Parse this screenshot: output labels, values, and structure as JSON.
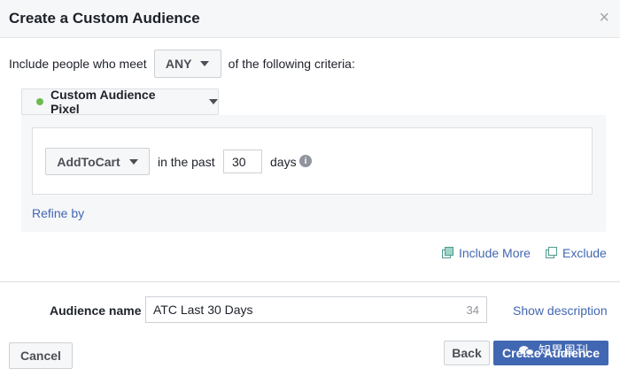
{
  "dialog": {
    "title": "Create a Custom Audience",
    "close_icon": "×"
  },
  "criteria": {
    "prefix": "Include people who meet",
    "match_value": "ANY",
    "suffix": "of the following criteria:"
  },
  "source": {
    "label": "Custom Audience Pixel",
    "status_color": "#6bbb4f"
  },
  "rule": {
    "event": "AddToCart",
    "in_the_past_label": "in the past",
    "days_value": "30",
    "days_label": "days",
    "info_icon": "i"
  },
  "refine_label": "Refine by",
  "include_more_label": "Include More",
  "exclude_label": "Exclude",
  "audience": {
    "name_label": "Audience name",
    "name_value": "ATC Last 30 Days",
    "chars_remaining": "34",
    "show_description_label": "Show description"
  },
  "footer": {
    "cancel_label": "Cancel",
    "back_label": "Back",
    "create_label": "Create Audience"
  },
  "watermark": {
    "text": "知界周刊"
  },
  "colors": {
    "link": "#4267b2",
    "primary_button": "#4267b2",
    "panel_bg": "#f6f7f9"
  }
}
